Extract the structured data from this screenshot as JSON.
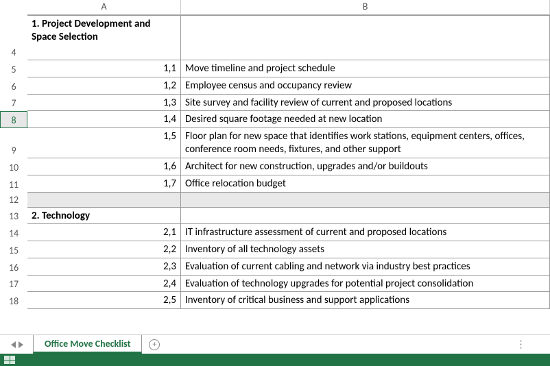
{
  "columns": {
    "A": "A",
    "B": "B"
  },
  "row_numbers": [
    "4",
    "5",
    "6",
    "7",
    "8",
    "9",
    "10",
    "11",
    "12",
    "13",
    "14",
    "15",
    "16",
    "17",
    "18"
  ],
  "active_row": "8",
  "section1": {
    "title": "1. Project Development and Space Selection",
    "items": [
      {
        "n": "1,1",
        "text": "Move timeline and project schedule"
      },
      {
        "n": "1,2",
        "text": "Employee census and occupancy review"
      },
      {
        "n": "1,3",
        "text": "Site survey and facility review of current and proposed locations"
      },
      {
        "n": "1,4",
        "text": "Desired square footage needed at new location"
      },
      {
        "n": "1,5",
        "text": "Floor plan for  new space that identifies work stations, equipment centers, offices, conference room needs, fixtures, and other support"
      },
      {
        "n": "1,6",
        "text": "Architect for new construction, upgrades and/or buildouts"
      },
      {
        "n": "1,7",
        "text": "Office relocation budget"
      }
    ]
  },
  "section2": {
    "title": "2. Technology",
    "items": [
      {
        "n": "2,1",
        "text": "IT infrastructure assessment of current and proposed locations"
      },
      {
        "n": "2,2",
        "text": "Inventory of all technology assets"
      },
      {
        "n": "2,3",
        "text": "Evaluation of current cabling and network via industry best practices"
      },
      {
        "n": "2,4",
        "text": "Evaluation of technology upgrades for potential project consolidation"
      },
      {
        "n": "2,5",
        "text": "Inventory of critical business and support applications"
      }
    ]
  },
  "tab_name": "Office Move Checklist",
  "chart_data": {
    "type": "table",
    "columns": [
      "A",
      "B"
    ],
    "rows": [
      [
        "1. Project Development and Space Selection",
        ""
      ],
      [
        "1,1",
        "Move timeline and project schedule"
      ],
      [
        "1,2",
        "Employee census and occupancy review"
      ],
      [
        "1,3",
        "Site survey and facility review of current and proposed locations"
      ],
      [
        "1,4",
        "Desired square footage needed at new location"
      ],
      [
        "1,5",
        "Floor plan for  new space that identifies work stations, equipment centers, offices, conference room needs, fixtures, and other support"
      ],
      [
        "1,6",
        "Architect for new construction, upgrades and/or buildouts"
      ],
      [
        "1,7",
        "Office relocation budget"
      ],
      [
        "",
        ""
      ],
      [
        "2. Technology",
        ""
      ],
      [
        "2,1",
        "IT infrastructure assessment of current and proposed locations"
      ],
      [
        "2,2",
        "Inventory of all technology assets"
      ],
      [
        "2,3",
        "Evaluation of current cabling and network via industry best practices"
      ],
      [
        "2,4",
        "Evaluation of technology upgrades for potential project consolidation"
      ],
      [
        "2,5",
        "Inventory of critical business and support applications"
      ]
    ]
  }
}
